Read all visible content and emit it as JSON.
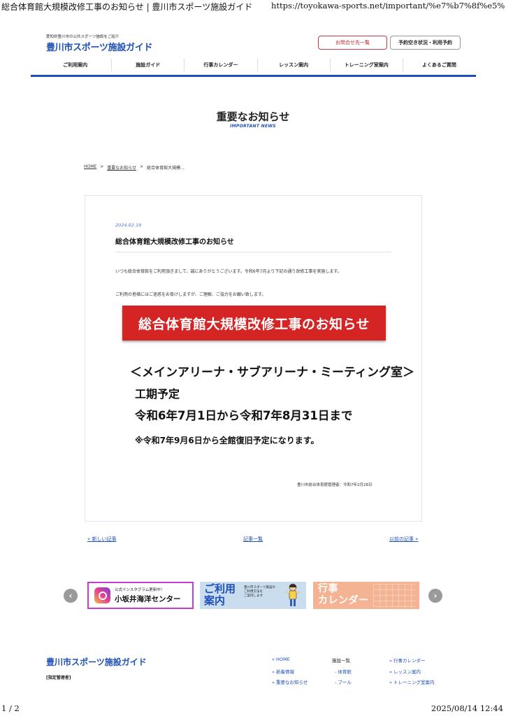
{
  "print": {
    "title": "総合体育館大規模改修工事のお知らせ | 豊川市スポーツ施設ガイド",
    "url": "https://toyokawa-sports.net/important/%e7%b7%8f%e5%9...",
    "page": "1 / 2",
    "datetime": "2025/08/14 12:44"
  },
  "header": {
    "tagline": "愛知県豊川市の公共スポーツ施設をご紹介",
    "logo": "豊川市スポーツ施設ガイド",
    "contact_button": "お問合せ先一覧",
    "reserve_button": "予約空き状況・利用予約"
  },
  "nav": [
    {
      "label": "ご利用案内"
    },
    {
      "label": "施設ガイド"
    },
    {
      "label": "行事カレンダー"
    },
    {
      "label": "レッスン案内"
    },
    {
      "label": "トレーニング室案内"
    },
    {
      "label": "よくあるご質問"
    }
  ],
  "page": {
    "title": "重要なお知らせ",
    "subtitle": "IMPORTANT NEWS"
  },
  "breadcrumb": {
    "home": "HOME",
    "sep": ">",
    "section": "重要なお知らせ",
    "current": "総合体育館大規模..."
  },
  "article": {
    "date": "2024.02.19",
    "title": "総合体育館大規模改修工事のお知らせ",
    "para1": "いつも総合体育館をご利用頂きまして、誠にありがとうございます。令和6年7月より下記の通り改修工事を実施します。",
    "para2": "ご利用の皆様にはご迷惑をお掛けしますが、ご理解、ご協力をお願い致します。",
    "banner": "総合体育館大規模改修工事のお知らせ",
    "venues": "＜メインアリーナ・サブアリーナ・ミーティング室＞",
    "period_label": "工期予定",
    "period_value": "令和6年7月1日から令和7年8月31日まで",
    "reopen": "※令和7年9月6日から全館復旧予定になります。",
    "manager": "豊川市総合体育館管理者：令和7年2月28日"
  },
  "post_nav": {
    "newer": "« 新しい記事",
    "list": "記事一覧",
    "older": "以前の記事 »"
  },
  "carousel": {
    "prev": "‹",
    "next": "›",
    "instagram_small": "公式インスタグラム更新中！",
    "instagram_big": "小坂井海洋センター",
    "guide_big": "ご利用\n案内",
    "guide_small": "豊川市スポーツ施設の\nご利用方法を\nご案内します",
    "calendar_big": "行事\nカレンダー"
  },
  "footer": {
    "logo": "豊川市スポーツ施設ガイド",
    "manager": "[指定管理者]",
    "col1": [
      "» HOME",
      "» 新着情報",
      "» 重要なお知らせ"
    ],
    "col2": [
      "施設一覧",
      "- 体育館",
      "- プール"
    ],
    "col3": [
      "» 行事カレンダー",
      "» レッスン案内",
      "» トレーニング室案内"
    ]
  },
  "colors": {
    "brand_blue": "#1e4fb8",
    "banner_red": "#d42424",
    "contact_red": "#c0282d",
    "instagram_border": "#c63bd0"
  }
}
